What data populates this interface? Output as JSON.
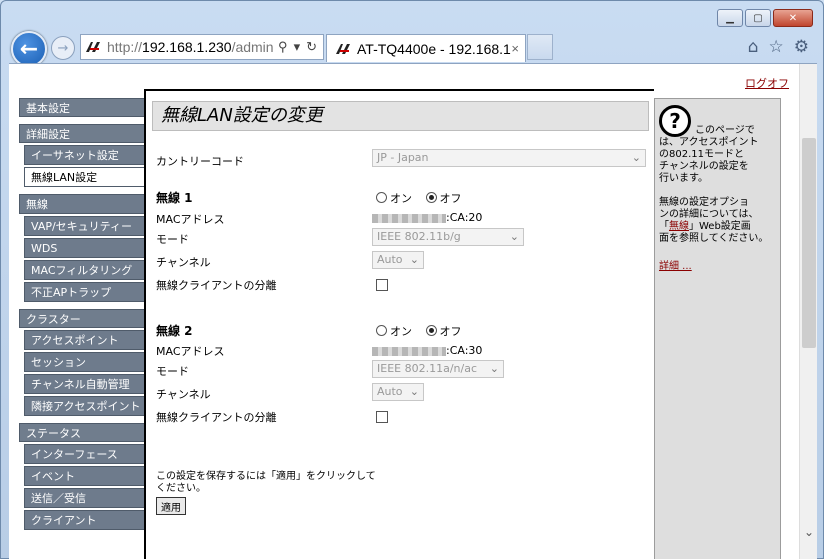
{
  "browser": {
    "address_proto": "http://",
    "address_host": "192.168.1.230",
    "address_path": "/admin",
    "tab_title": "AT-TQ4400e - 192.168.1...",
    "tab_close": "×"
  },
  "page": {
    "logout_label": "ログオフ",
    "title": "無線LAN設定の変更"
  },
  "sidebar": {
    "basic": "基本設定",
    "detail": "詳細設定",
    "ethernet": "イーサネット設定",
    "wireless_lan": "無線LAN設定",
    "wireless": "無線",
    "vap": "VAP/セキュリティー",
    "wds": "WDS",
    "mac_filter": "MACフィルタリング",
    "rogue_ap": "不正APトラップ",
    "cluster": "クラスター",
    "access_points": "アクセスポイント",
    "session": "セッション",
    "channel_auto": "チャンネル自動管理",
    "neighbor_ap": "隣接アクセスポイント",
    "status": "ステータス",
    "interface": "インターフェース",
    "event": "イベント",
    "txrx": "送信／受信",
    "client": "クライアント"
  },
  "form": {
    "country_label": "カントリーコード",
    "country_value": "JP - Japan",
    "radio1": {
      "title": "無線 1",
      "on_label": "オン",
      "off_label": "オフ",
      "mac_label": "MACアドレス",
      "mac_suffix": ":CA:20",
      "mode_label": "モード",
      "mode_value": "IEEE 802.11b/g",
      "channel_label": "チャンネル",
      "channel_value": "Auto",
      "isolation_label": "無線クライアントの分離"
    },
    "radio2": {
      "title": "無線 2",
      "on_label": "オン",
      "off_label": "オフ",
      "mac_label": "MACアドレス",
      "mac_suffix": ":CA:30",
      "mode_label": "モード",
      "mode_value": "IEEE 802.11a/n/ac",
      "channel_label": "チャンネル",
      "channel_value": "Auto",
      "isolation_label": "無線クライアントの分離"
    },
    "save_note_1": "この設定を保存するには「適用」をクリックして",
    "save_note_2": "ください。",
    "apply_label": "適用"
  },
  "help": {
    "icon": "?",
    "text1_a": "このページで",
    "text1_b": "は、アクセスポイント",
    "text1_c": "の802.11モードと",
    "text1_d": "チャンネルの設定を",
    "text1_e": "行います。",
    "text2_a": "無線の設定オプショ",
    "text2_b": "ンの詳細については、",
    "text2_c_pre": "「",
    "text2_c_link": "無線",
    "text2_c_post": "」Web設定画",
    "text2_d": "面を参照してください。",
    "more_label": "詳細 ..."
  }
}
